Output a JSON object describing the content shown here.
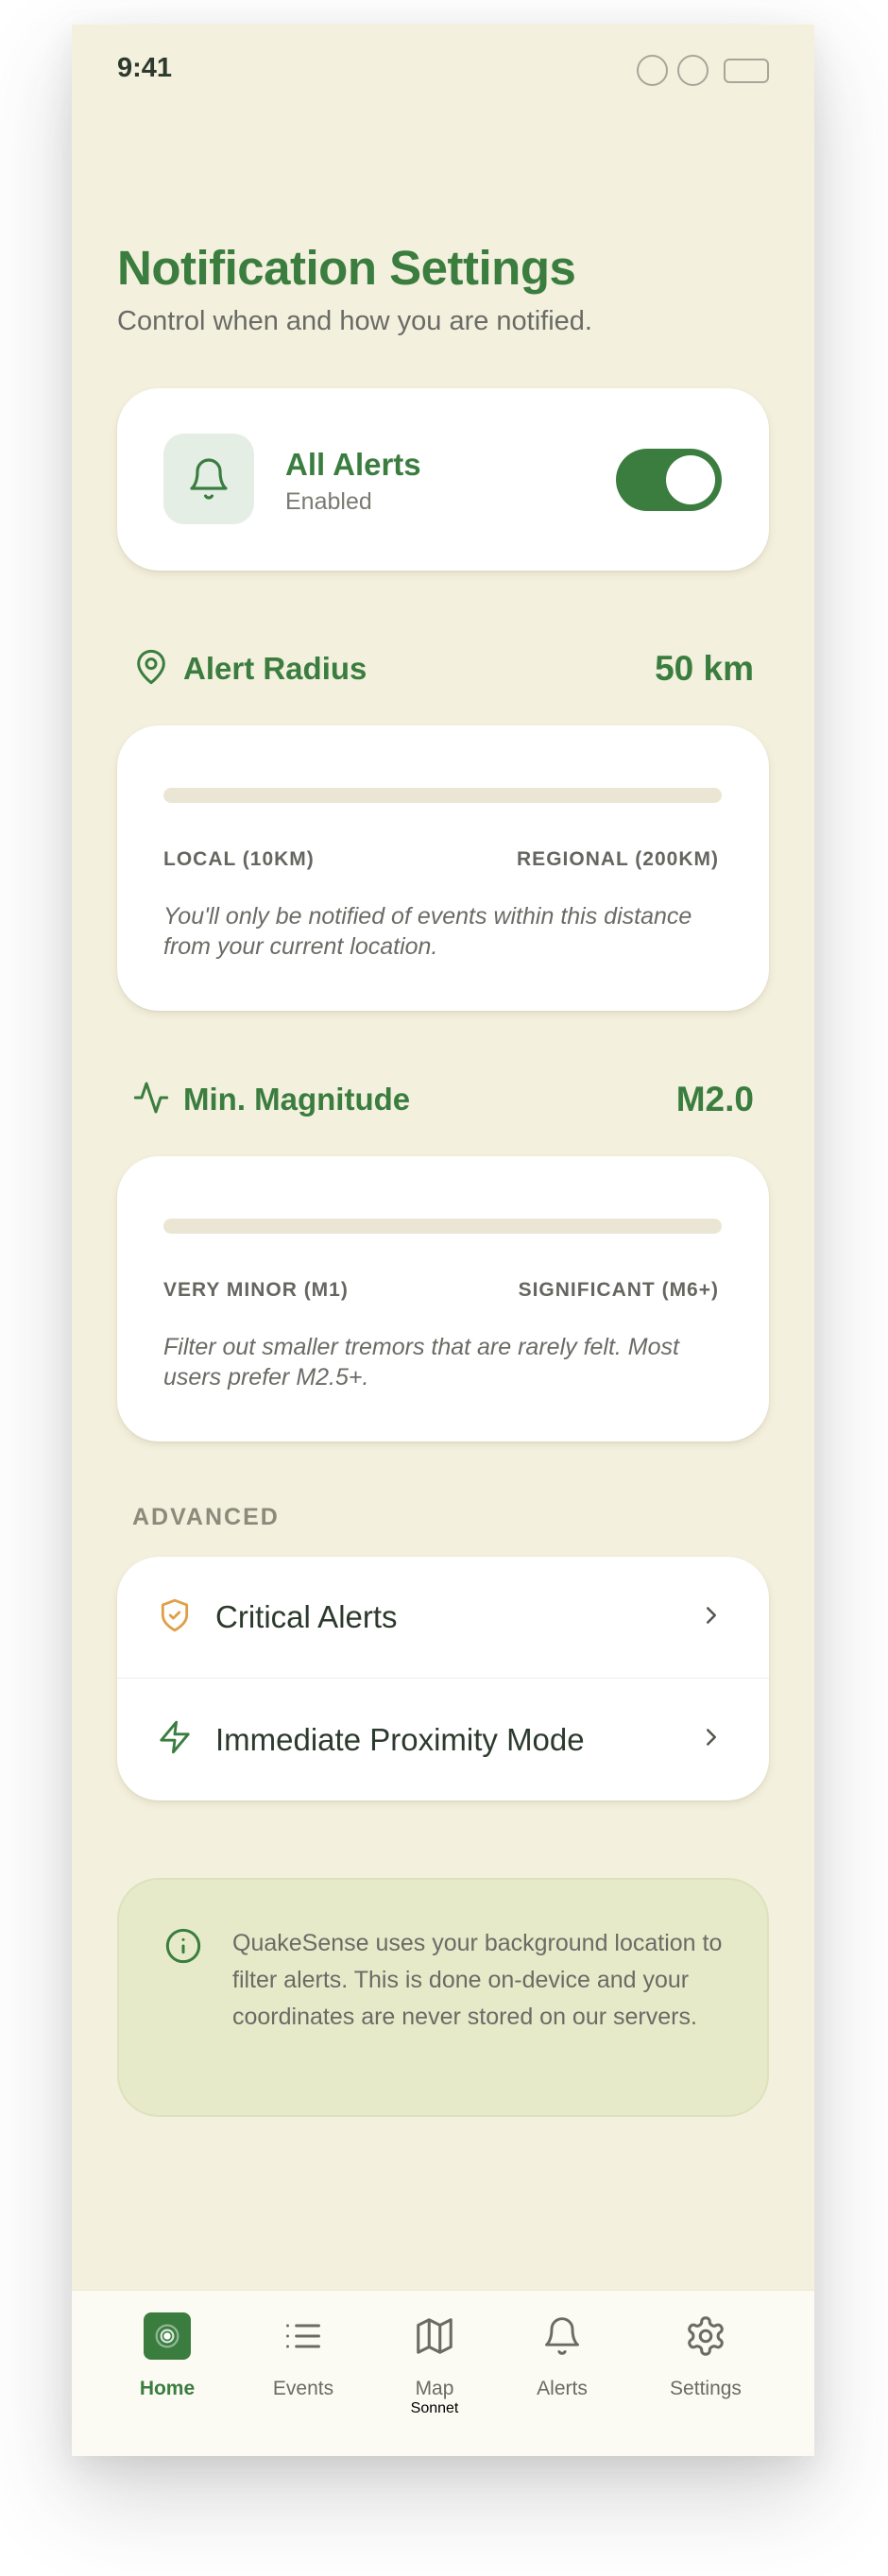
{
  "status_bar": {
    "time": "9:41"
  },
  "header": {
    "title": "Notification Settings",
    "subtitle": "Control when and how you are notified."
  },
  "all_alerts": {
    "title": "All Alerts",
    "status": "Enabled",
    "enabled": true
  },
  "alert_radius": {
    "label": "Alert Radius",
    "value": "50 km",
    "min_label": "LOCAL (10KM)",
    "max_label": "REGIONAL (200KM)",
    "helper": "You'll only be notified of events within this distance from your current location."
  },
  "min_magnitude": {
    "label": "Min. Magnitude",
    "value": "M2.0",
    "min_label": "VERY MINOR (M1)",
    "max_label": "SIGNIFICANT (M6+)",
    "helper": "Filter out smaller tremors that are rarely felt. Most users prefer M2.5+."
  },
  "advanced": {
    "section_label": "ADVANCED",
    "items": [
      {
        "label": "Critical Alerts",
        "icon": "shield-check-icon"
      },
      {
        "label": "Immediate Proximity Mode",
        "icon": "lightning-icon"
      }
    ]
  },
  "info": {
    "text": "QuakeSense uses your background location to filter alerts. This is done on-device and your coordinates are never stored on our servers."
  },
  "tabbar": {
    "items": [
      {
        "label": "Home",
        "icon": "home-radar-icon",
        "active": true
      },
      {
        "label": "Events",
        "icon": "list-icon",
        "active": false
      },
      {
        "label": "Map",
        "icon": "map-icon",
        "active": false
      },
      {
        "label": "Alerts",
        "icon": "bell-icon",
        "active": false
      },
      {
        "label": "Settings",
        "icon": "gear-icon",
        "active": false
      }
    ]
  },
  "colors": {
    "primary": "#3a7d3f",
    "background": "#f3f0dd",
    "card": "#ffffff",
    "critical_accent": "#e0a04a",
    "info_background": "#e6eac8"
  }
}
